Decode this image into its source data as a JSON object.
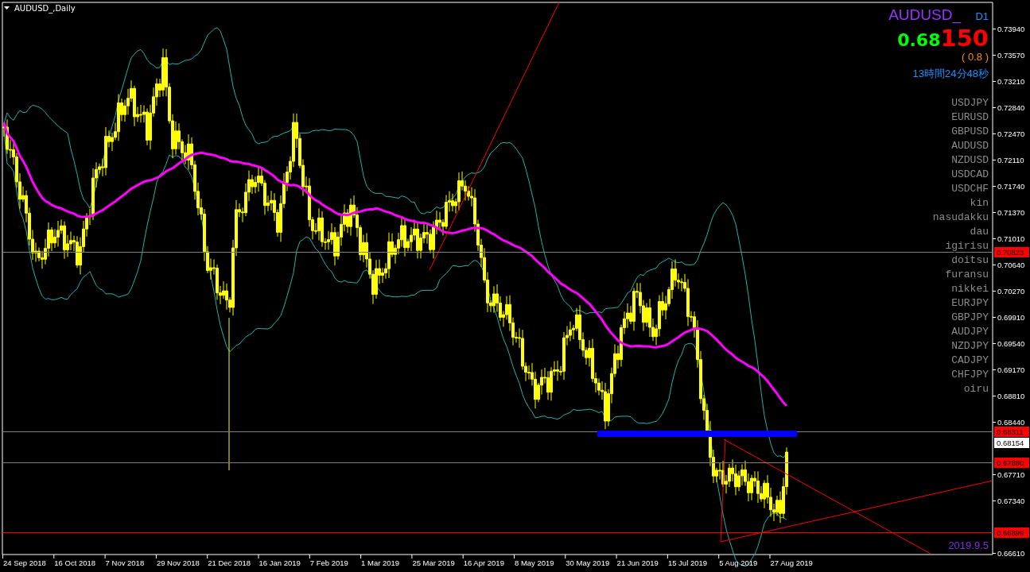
{
  "chart": {
    "title": "AUDUSD_,Daily",
    "symbol": "AUDUSD_",
    "timeframe": "D1",
    "price_main": "0.68",
    "price_big": "150",
    "change": "( 0.8 )",
    "countdown": "13時間24分48秒",
    "symbols": [
      "USDJPY",
      "EURUSD",
      "GBPUSD",
      "AUDUSD",
      "NZDUSD",
      "USDCAD",
      "USDCHF",
      "kin",
      "nasudakku",
      "dau",
      "igirisu",
      "doitsu",
      "furansu",
      "nikkei",
      "EURJPY",
      "GBPJPY",
      "AUDJPY",
      "NZDJPY",
      "CADJPY",
      "CHFJPY",
      "oiru"
    ],
    "price_ticks": [
      "0.73940",
      "0.73570",
      "0.73210",
      "0.72840",
      "0.72470",
      "0.72110",
      "0.71740",
      "0.71370",
      "0.71010",
      "0.70640",
      "0.70270",
      "0.69910",
      "0.69540",
      "0.69170",
      "0.68810",
      "0.68440",
      "0.67710",
      "0.67340",
      "0.66610"
    ],
    "level_tags": [
      {
        "value": "0.70823",
        "kind": "alert",
        "color": "#808080"
      },
      {
        "value": "0.68311",
        "kind": "alert",
        "color": "#808080"
      },
      {
        "value": "0.68154",
        "kind": "bid"
      },
      {
        "value": "0.67880",
        "kind": "alert",
        "color": "#808080"
      },
      {
        "value": "0.66899",
        "kind": "alert",
        "color": "#ff0000"
      }
    ],
    "date_label": "2019.9.5",
    "dates": [
      "24 Sep 2018",
      "16 Oct 2018",
      "7 Nov 2018",
      "29 Nov 2018",
      "21 Dec 2018",
      "16 Jan 2019",
      "7 Feb 2019",
      "1 Mar 2019",
      "25 Mar 2019",
      "16 Apr 2019",
      "8 May 2019",
      "30 May 2019",
      "21 Jun 2019",
      "15 Jul 2019",
      "5 Aug 2019",
      "27 Aug 2019"
    ]
  }
}
